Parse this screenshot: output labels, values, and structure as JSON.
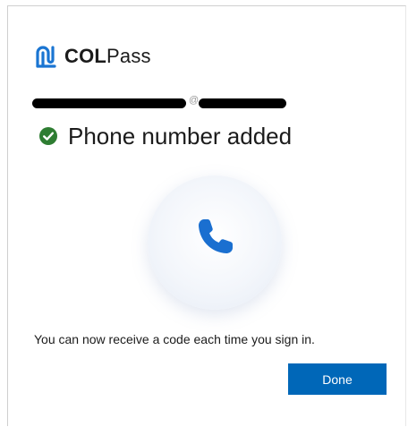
{
  "brand": {
    "name_bold": "COL",
    "name_light": "Pass",
    "accent_color": "#1a75d2"
  },
  "account": {
    "email_visible_fragment": "@"
  },
  "status": {
    "icon": "check-circle-icon",
    "icon_color": "#2e7d32",
    "title": "Phone number added"
  },
  "illustration": {
    "icon": "phone-icon",
    "icon_color": "#1a6fd0"
  },
  "message": "You can now receive a code each time you sign in.",
  "actions": {
    "done_label": "Done",
    "done_color": "#0067b8"
  }
}
